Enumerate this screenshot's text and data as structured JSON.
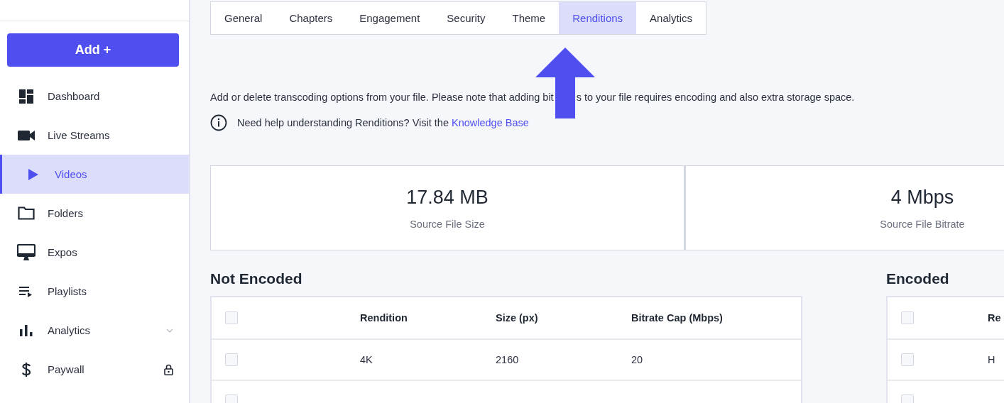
{
  "sidebar": {
    "add_button": "Add +",
    "items": [
      {
        "label": "Dashboard",
        "selected": false
      },
      {
        "label": "Live Streams",
        "selected": false
      },
      {
        "label": "Videos",
        "selected": true
      },
      {
        "label": "Folders",
        "selected": false
      },
      {
        "label": "Expos",
        "selected": false
      },
      {
        "label": "Playlists",
        "selected": false
      },
      {
        "label": "Analytics",
        "selected": false,
        "expanded": false
      },
      {
        "label": "Paywall",
        "selected": false,
        "locked": true
      }
    ]
  },
  "tabs": [
    {
      "label": "General",
      "selected": false
    },
    {
      "label": "Chapters",
      "selected": false
    },
    {
      "label": "Engagement",
      "selected": false
    },
    {
      "label": "Security",
      "selected": false
    },
    {
      "label": "Theme",
      "selected": false
    },
    {
      "label": "Renditions",
      "selected": true
    },
    {
      "label": "Analytics",
      "selected": false
    }
  ],
  "description": {
    "before_arrow": "Add or delete transcoding options from your file. Please note that adding bit",
    "after_arrow": "s to your file requires encoding and also extra storage space."
  },
  "help": {
    "text": "Need help understanding Renditions? Visit the",
    "link": "Knowledge Base"
  },
  "stats": [
    {
      "value": "17.84 MB",
      "label": "Source File Size"
    },
    {
      "value": "4 Mbps",
      "label": "Source File Bitrate"
    }
  ],
  "not_encoded": {
    "title": "Not Encoded",
    "all_checked": false,
    "columns": [
      "Rendition",
      "Size (px)",
      "Bitrate Cap (Mbps)"
    ],
    "rows": [
      {
        "checked": false,
        "cells": [
          "4K",
          "2160",
          "20"
        ]
      },
      {
        "checked": false
      }
    ]
  },
  "encoded": {
    "title": "Encoded",
    "all_checked": false,
    "columns": [
      "Re"
    ],
    "rows": [
      {
        "checked": false,
        "cells": [
          "H"
        ]
      },
      {
        "checked": false
      }
    ]
  }
}
